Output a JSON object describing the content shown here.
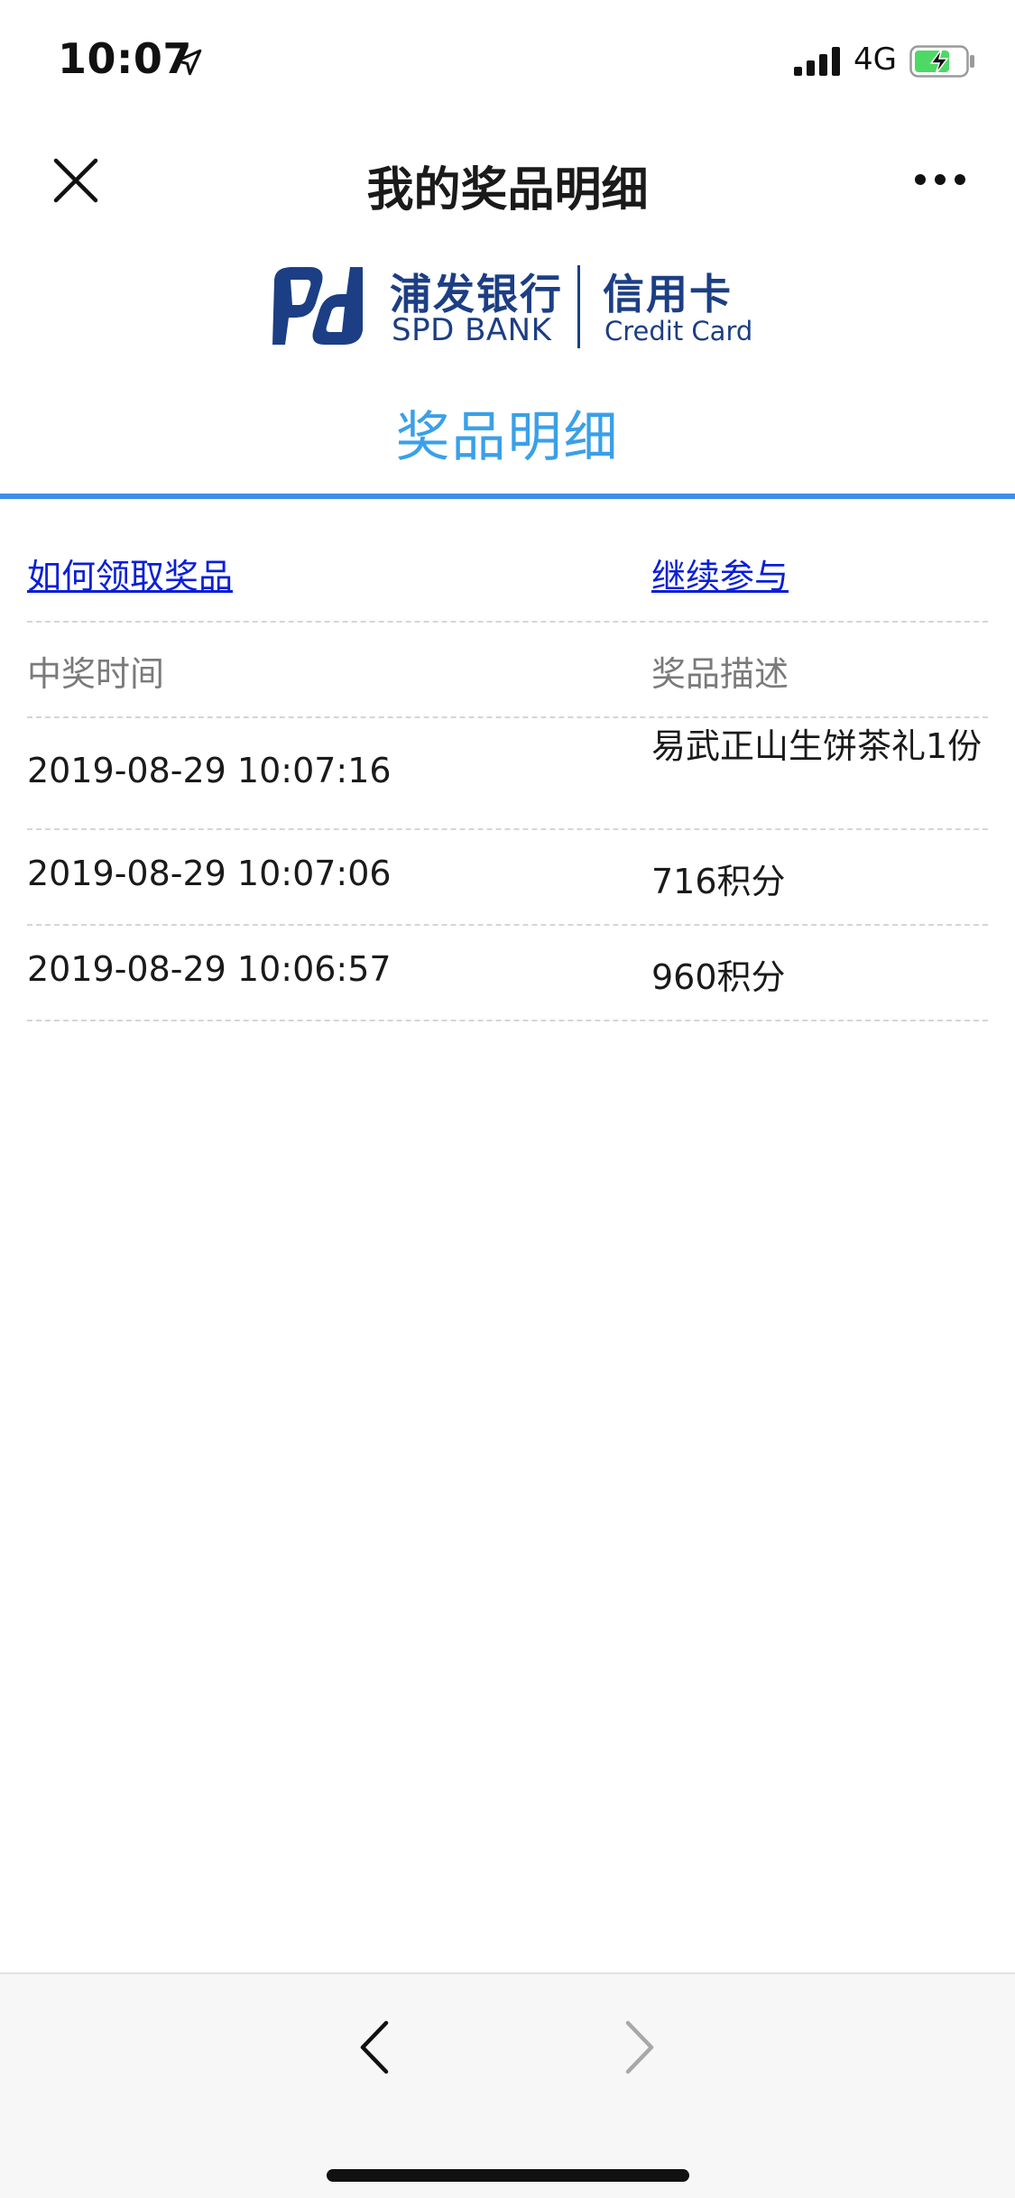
{
  "status_bar": {
    "time": "10:07",
    "network": "4G",
    "icons": [
      "location-arrow-icon",
      "signal-bars-icon",
      "battery-charging-icon"
    ]
  },
  "nav": {
    "title": "我的奖品明细",
    "close_icon": "close-icon",
    "more_icon": "more-dots-icon"
  },
  "logo": {
    "bank_cn": "浦发银行",
    "bank_en": "SPD BANK",
    "card_cn": "信用卡",
    "card_en": "Credit Card"
  },
  "section": {
    "title": "奖品明细",
    "accent_color": "#3aa0e8",
    "rule_color": "#3d8de6"
  },
  "links": {
    "how_to_claim": "如何领取奖品",
    "continue": "继续参与",
    "color": "#0a1fd6"
  },
  "table": {
    "headers": {
      "time": "中奖时间",
      "desc": "奖品描述"
    },
    "rows": [
      {
        "time": "2019-08-29 10:07:16",
        "desc": "易武正山生饼茶礼1份"
      },
      {
        "time": "2019-08-29 10:07:06",
        "desc": "716积分"
      },
      {
        "time": "2019-08-29 10:06:57",
        "desc": "960积分"
      }
    ]
  },
  "bottom_bar": {
    "back_icon": "chevron-left-icon",
    "forward_icon": "chevron-right-icon"
  }
}
